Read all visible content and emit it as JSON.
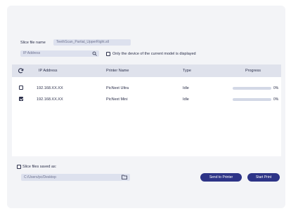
{
  "slice_file_name": {
    "label": "Slice file name",
    "value": "TeethScan_Partial_UpperRight.stl"
  },
  "search": {
    "placeholder": "IP Address"
  },
  "only_current_model": {
    "label": "Only the device of the current model is displayed",
    "checked": false
  },
  "table": {
    "columns": [
      "IP Address",
      "Printer Name",
      "Type",
      "Progress"
    ],
    "rows": [
      {
        "checked": false,
        "ip": "192.168.XX.XX",
        "name": "PicNext Ultra",
        "type": "Idle",
        "progress": 0,
        "progress_label": "0%"
      },
      {
        "checked": true,
        "ip": "192.168.XX.XX",
        "name": "PicNext Mini",
        "type": "Idle",
        "progress": 0,
        "progress_label": "0%"
      }
    ]
  },
  "save": {
    "label": "Slice files saved as:",
    "checked": false,
    "path": "C:/Users/pc/Desktop"
  },
  "buttons": {
    "send": "Send to Printer",
    "start": "Start Print"
  },
  "colors": {
    "accent": "#2d3487",
    "field": "#dde1ee",
    "header": "#dfe2ec"
  }
}
